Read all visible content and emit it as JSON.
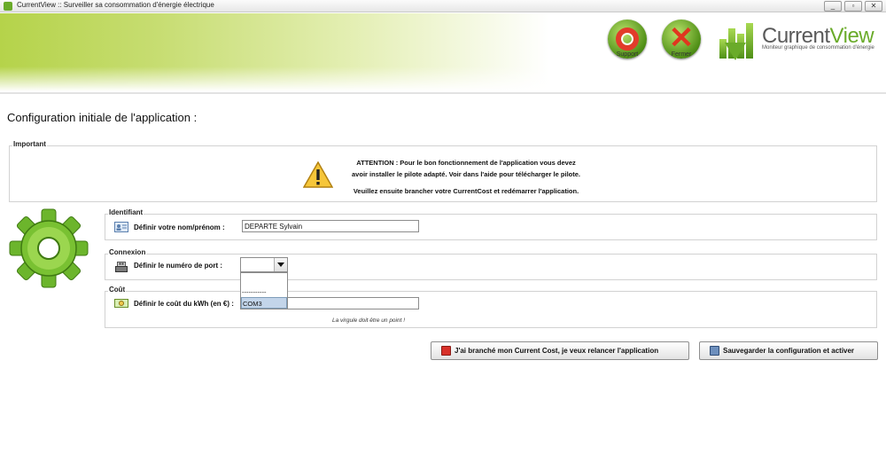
{
  "window": {
    "title": "CurrentView :: Surveiller sa consommation d'énergie électrique",
    "controls": {
      "minimize": "_",
      "maximize": "▫",
      "close": "✕"
    }
  },
  "header": {
    "support_label": "Support",
    "close_label": "Fermer",
    "logo_prefix": "Current",
    "logo_suffix": "View",
    "logo_tagline": "Moniteur graphique de consommation d'énergie",
    "brand_color": "#6aab2a"
  },
  "page": {
    "title": "Configuration initiale de l'application :"
  },
  "important": {
    "legend": "Important",
    "line1": "ATTENTION : Pour le bon fonctionnement de l'application vous devez",
    "line2": "avoir installer le pilote adapté. Voir dans l'aide pour télécharger le pilote.",
    "line3": "Veuillez ensuite brancher votre CurrentCost et redémarrer l'application."
  },
  "ident": {
    "legend": "Identifiant",
    "label": "Définir votre nom/prénom :",
    "value": "DEPARTE Sylvain"
  },
  "connexion": {
    "legend": "Connexion",
    "label": "Définir le numéro de port :",
    "selected": "",
    "options": [
      "",
      "-----------",
      "COM3"
    ]
  },
  "cout": {
    "legend": "Coût",
    "label": "Définir le coût du kWh (en €) :",
    "value": "",
    "hint": "La virgule doit être un point !"
  },
  "buttons": {
    "restart": "J'ai branché mon Current Cost, je veux relancer l'application",
    "save": "Sauvegarder la configuration et activer"
  },
  "icons": {
    "warning": "warning-icon",
    "gear": "gear-icon",
    "user": "user-card-icon",
    "port": "usb-plug-icon",
    "money": "money-icon"
  }
}
